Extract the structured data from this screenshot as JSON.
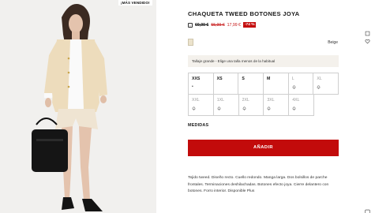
{
  "image": {
    "badge": "¡MÁS VENDIDO!"
  },
  "product": {
    "title": "CHAQUETA TWEED BOTONES JOYA",
    "price_original": "69,99 €",
    "price_previous": "55,99 €",
    "price_current": "17,99 €",
    "discount": "-74 %",
    "color_name": "Beige",
    "fit_note": "Tallaje grande - Elige una talla menos de la habitual",
    "sizes": [
      {
        "label": "XXS",
        "mark": "•",
        "available": true
      },
      {
        "label": "XS",
        "mark": "",
        "available": true
      },
      {
        "label": "S",
        "mark": "",
        "available": true
      },
      {
        "label": "M",
        "mark": "",
        "available": true
      },
      {
        "label": "L",
        "mark": "bell-icon",
        "available": false
      },
      {
        "label": "XL",
        "mark": "bell-icon",
        "available": false
      },
      {
        "label": "XXL",
        "mark": "bell-icon",
        "available": false
      },
      {
        "label": "1XL",
        "mark": "bell-icon",
        "available": false
      },
      {
        "label": "2XL",
        "mark": "bell-icon",
        "available": false
      },
      {
        "label": "3XL",
        "mark": "bell-icon",
        "available": false
      },
      {
        "label": "4XL",
        "mark": "bell-icon",
        "available": false
      }
    ],
    "measures_label": "MEDIDAS",
    "add_button": "AÑADIR",
    "description": "Tejido tweed. Diseño recto. Cuello redondo. Manga larga. Dos bolsillos de parche frontales. Terminaciones deshilachadas. Botones efecto joya. Cierre delantero con botones. Forro interior. Disponible Plus"
  },
  "colors": {
    "accent": "#c20b0b",
    "swatch": "#ece3cc",
    "note_bg": "#f4f1ec"
  }
}
